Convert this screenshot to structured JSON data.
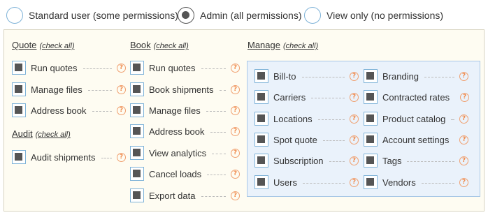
{
  "roles": [
    {
      "label": "Standard user (some permissions)",
      "selected": false
    },
    {
      "label": "Admin (all permissions)",
      "selected": true
    },
    {
      "label": "View only (no permissions)",
      "selected": false
    }
  ],
  "help_glyph": "?",
  "check_all_label": "(check all)",
  "sections": {
    "quote": {
      "title": "Quote",
      "items": [
        "Run quotes",
        "Manage files",
        "Address book"
      ]
    },
    "audit": {
      "title": "Audit",
      "items": [
        "Audit shipments"
      ]
    },
    "book": {
      "title": "Book",
      "items": [
        "Run quotes",
        "Book shipments",
        "Manage files",
        "Address book",
        "View analytics",
        "Cancel loads",
        "Export data"
      ]
    },
    "manage": {
      "title": "Manage",
      "left_items": [
        "Bill-to",
        "Carriers",
        "Locations",
        "Spot quote",
        "Subscription",
        "Users"
      ],
      "right_items": [
        "Branding",
        "Contracted rates",
        "Product catalog",
        "Account settings",
        "Tags",
        "Vendors"
      ]
    }
  },
  "colors": {
    "accent_border": "#7fb3d8",
    "help": "#f08848",
    "panel_bg": "#fefcf2",
    "manage_bg": "#eaf2fb"
  }
}
